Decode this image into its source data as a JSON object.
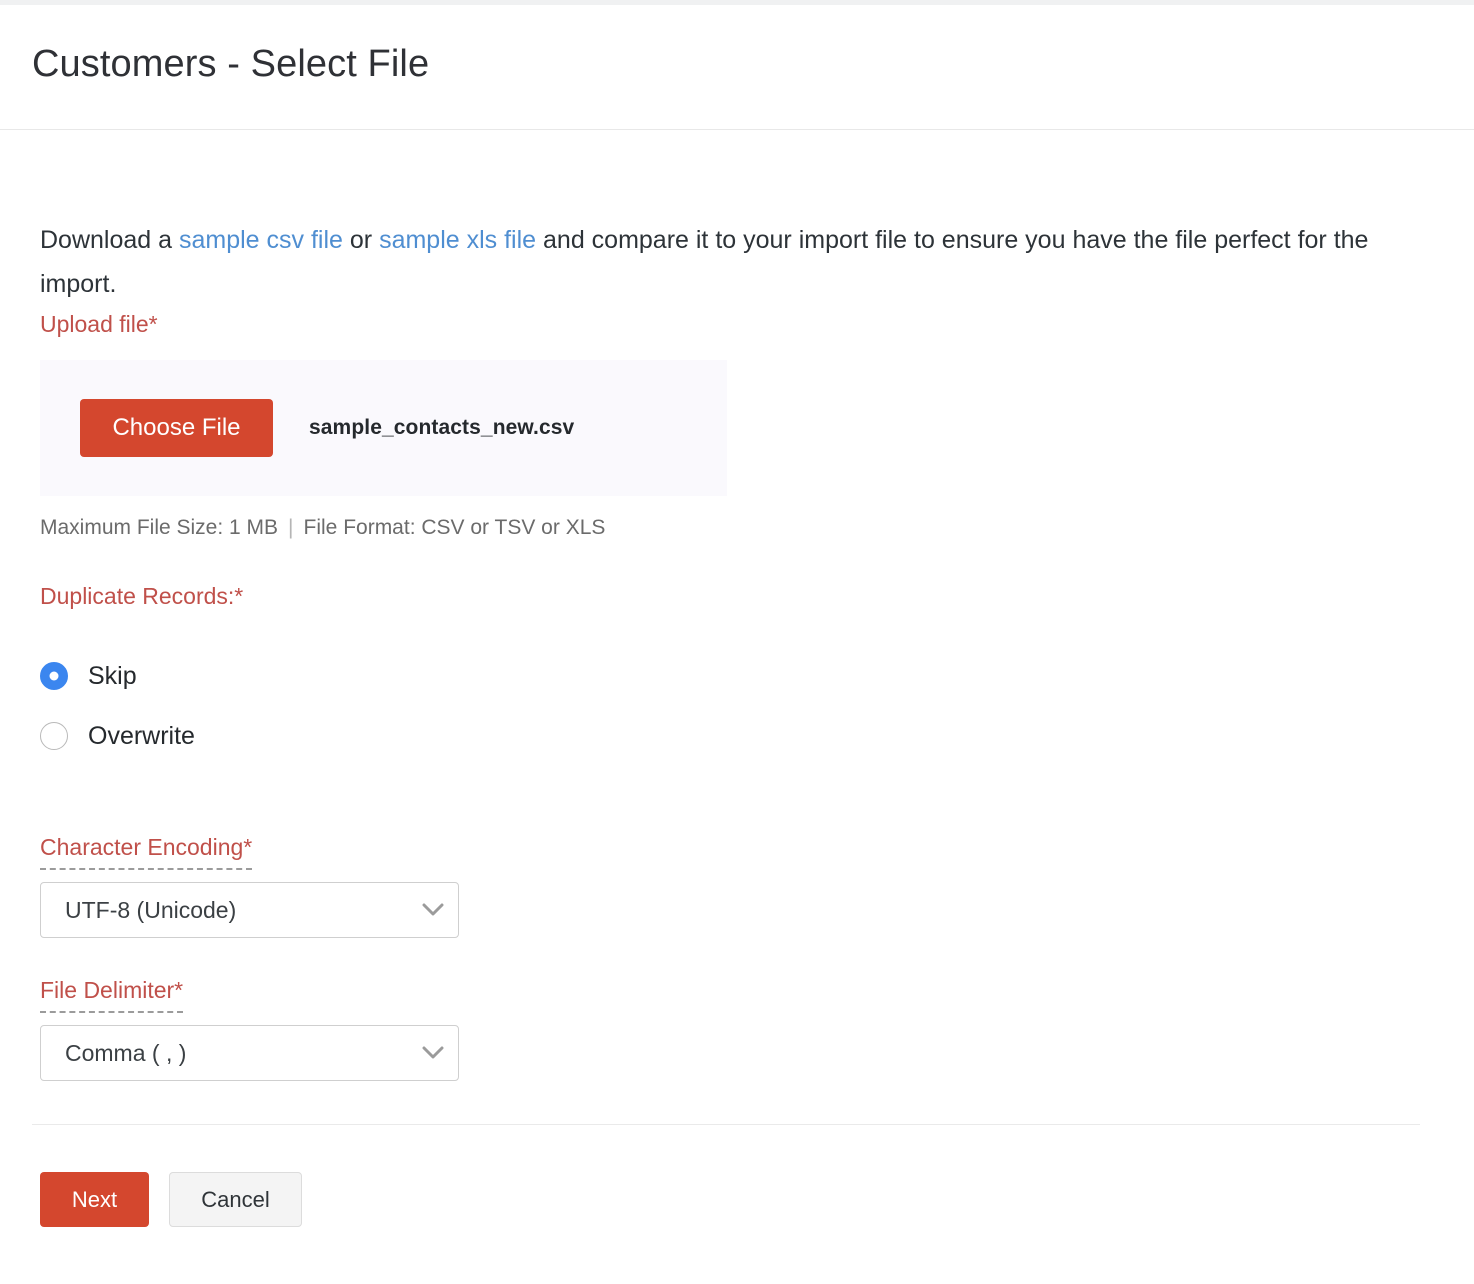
{
  "header": {
    "title": "Customers - Select File"
  },
  "intro": {
    "text_before": "Download a ",
    "link_csv": "sample csv file",
    "text_between": " or ",
    "link_xls": "sample xls file",
    "text_after": " and compare it to your import file to ensure you have the file perfect for the import."
  },
  "upload": {
    "label": "Upload file*",
    "choose_button": "Choose File",
    "file_name": "sample_contacts_new.csv",
    "hint_size": "Maximum File Size: 1 MB",
    "hint_separator": "|",
    "hint_format": "File Format: CSV or TSV or XLS"
  },
  "duplicate_records": {
    "label": "Duplicate Records:*",
    "options": [
      {
        "label": "Skip",
        "selected": true
      },
      {
        "label": "Overwrite",
        "selected": false
      }
    ]
  },
  "character_encoding": {
    "label": "Character Encoding*",
    "value": "UTF-8 (Unicode)",
    "chevron_icon": "chevron-down-icon"
  },
  "file_delimiter": {
    "label": "File Delimiter*",
    "value": "Comma ( , )",
    "chevron_icon": "chevron-down-icon"
  },
  "footer": {
    "next_label": "Next",
    "cancel_label": "Cancel"
  },
  "colors": {
    "primary_red": "#d4472e",
    "label_red": "#c0504a",
    "link_blue": "#4f8ed1",
    "radio_blue": "#3b86ef",
    "upload_bg": "#faf9fd"
  }
}
